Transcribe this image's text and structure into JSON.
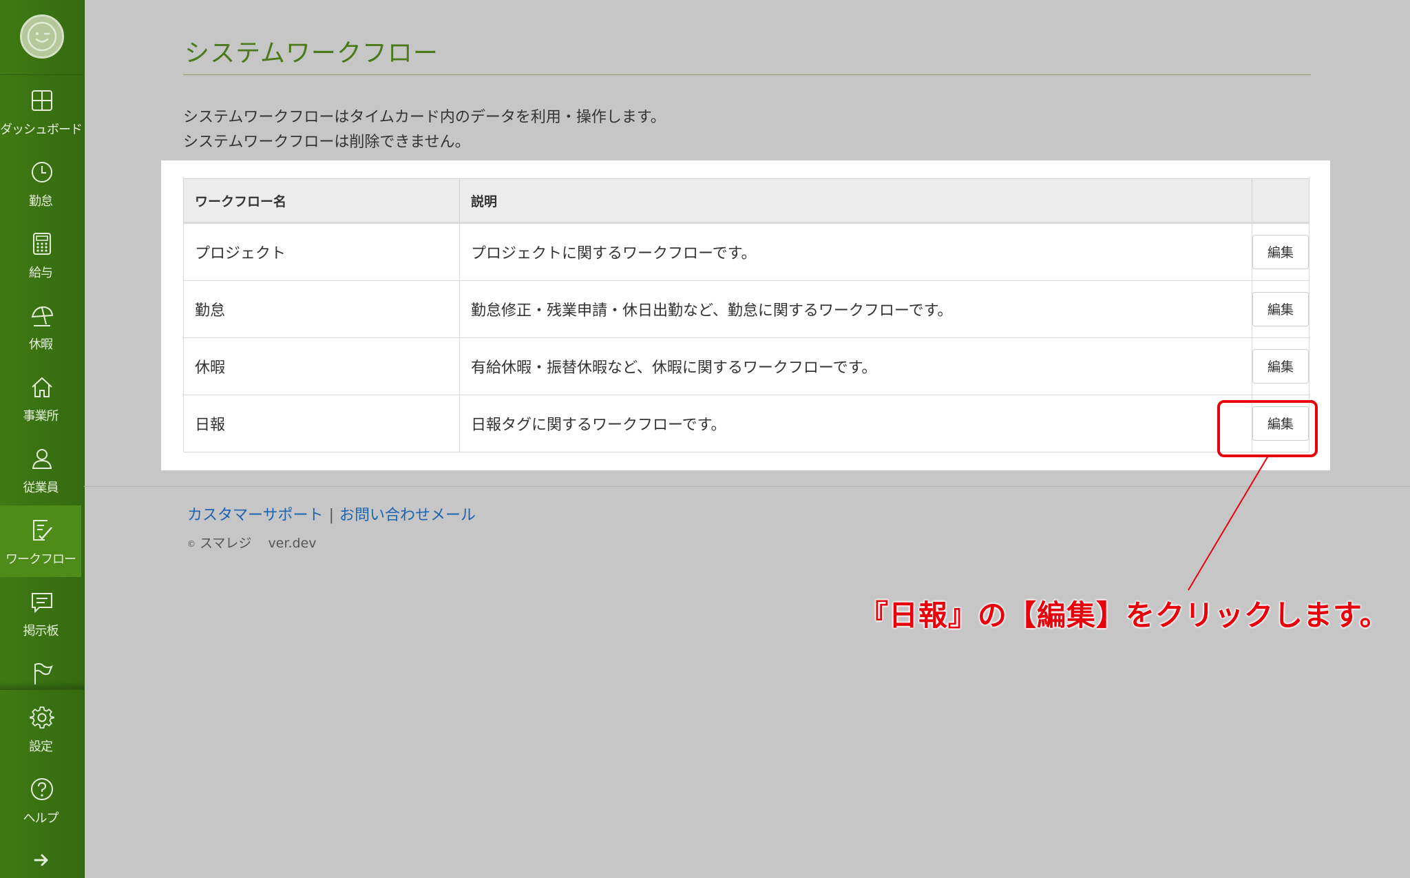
{
  "sidebar": {
    "items": [
      {
        "label": "ダッシュボード",
        "icon": "dashboard-icon"
      },
      {
        "label": "勤怠",
        "icon": "clock-icon"
      },
      {
        "label": "給与",
        "icon": "calculator-icon"
      },
      {
        "label": "休暇",
        "icon": "umbrella-icon"
      },
      {
        "label": "事業所",
        "icon": "home-icon"
      },
      {
        "label": "従業員",
        "icon": "person-icon"
      },
      {
        "label": "ワークフロー",
        "icon": "checklist-icon",
        "active": true
      },
      {
        "label": "掲示板",
        "icon": "chat-icon"
      },
      {
        "label": "",
        "icon": "flag-icon"
      },
      {
        "label": "設定",
        "icon": "gear-icon"
      },
      {
        "label": "ヘルプ",
        "icon": "help-icon"
      }
    ],
    "expand_icon": "arrow-right-icon"
  },
  "page": {
    "title": "システムワークフロー",
    "description_line1": "システムワークフローはタイムカード内のデータを利用・操作します。",
    "description_line2": "システムワークフローは削除できません。"
  },
  "table": {
    "headers": [
      "ワークフロー名",
      "説明",
      ""
    ],
    "rows": [
      {
        "name": "プロジェクト",
        "description": "プロジェクトに関するワークフローです。",
        "action": "編集"
      },
      {
        "name": "勤怠",
        "description": "勤怠修正・残業申請・休日出勤など、勤怠に関するワークフローです。",
        "action": "編集"
      },
      {
        "name": "休暇",
        "description": "有給休暇・振替休暇など、休暇に関するワークフローです。",
        "action": "編集"
      },
      {
        "name": "日報",
        "description": "日報タグに関するワークフローです。",
        "action": "編集"
      }
    ]
  },
  "footer": {
    "link_support": "カスタマーサポート",
    "separator": "|",
    "link_mail": "お問い合わせメール",
    "copyright_symbol": "©",
    "company": "スマレジ",
    "version": "ver.dev"
  },
  "annotation": {
    "text": "『日報』の【編集】をクリックします。",
    "color": "#e8000b"
  },
  "colors": {
    "sidebar_bg": "#3f7a14",
    "sidebar_active": "#4e8c1a",
    "title_green": "#4a7a1a",
    "link_blue": "#1d64b0",
    "page_bg": "#c6c6c6"
  }
}
